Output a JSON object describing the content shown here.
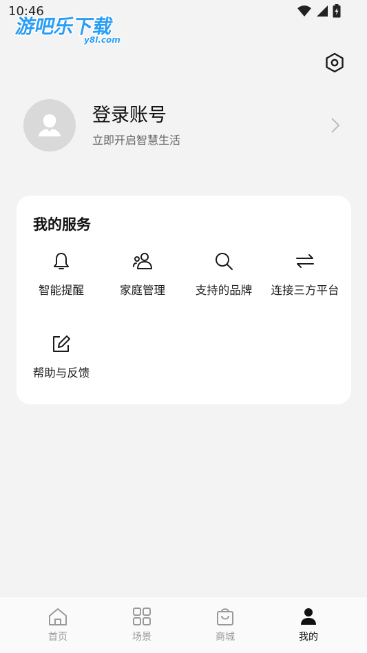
{
  "status_bar": {
    "time": "10:46"
  },
  "watermark": {
    "text": "游吧乐下载",
    "sub": "y8l.com"
  },
  "profile": {
    "title": "登录账号",
    "subtitle": "立即开启智慧生活"
  },
  "services": {
    "title": "我的服务",
    "items": [
      {
        "label": "智能提醒",
        "icon": "bell-icon"
      },
      {
        "label": "家庭管理",
        "icon": "family-icon"
      },
      {
        "label": "支持的品牌",
        "icon": "search-icon"
      },
      {
        "label": "连接三方平台",
        "icon": "swap-icon"
      },
      {
        "label": "帮助与反馈",
        "icon": "edit-icon"
      }
    ]
  },
  "tabbar": {
    "items": [
      {
        "label": "首页",
        "icon": "home-icon"
      },
      {
        "label": "场景",
        "icon": "grid-icon"
      },
      {
        "label": "商城",
        "icon": "shopping-bag-icon"
      },
      {
        "label": "我的",
        "icon": "user-icon",
        "active": true
      }
    ]
  },
  "colors": {
    "background": "#f3f3f3",
    "card": "#ffffff",
    "active_tab": "#111111",
    "inactive_tab": "#999999"
  }
}
